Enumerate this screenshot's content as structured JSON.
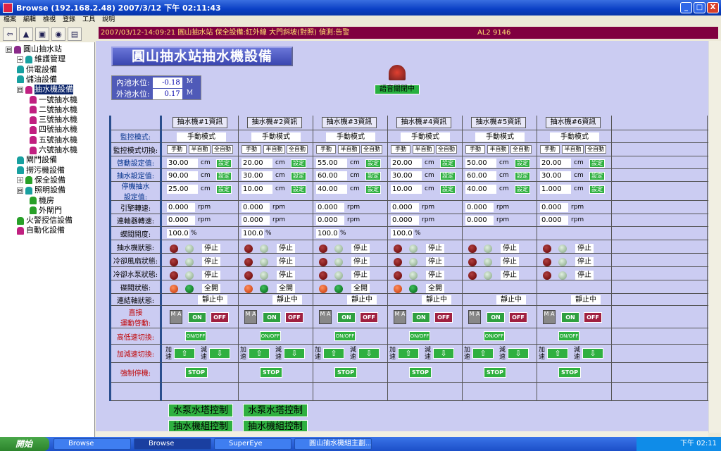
{
  "window": {
    "title": "Browse (192.168.2.48)   2007/3/12 下午 02:11:43",
    "min": "_",
    "max": "□",
    "close": "X"
  },
  "menu": [
    "檔案",
    "編輯",
    "檢視",
    "登錄",
    "工具",
    "說明"
  ],
  "toolbar": [
    "⇦",
    "▲",
    "▣",
    "◉",
    "▤"
  ],
  "alarm": {
    "text": "2007/03/12-14:09:21  圓山抽水站 保全設備:紅外線 大門斜坡(對照) 偵測:告警",
    "code": "AL2 9146"
  },
  "tree": [
    {
      "label": "圓山抽水站",
      "icon": "station-icon",
      "color": "#8a2a8a",
      "exp": "⊟"
    },
    {
      "label": "維護管理",
      "icon": "node-icon",
      "color": "#18a0a0",
      "exp": "+"
    },
    {
      "label": "供電設備",
      "icon": "node-icon",
      "color": "#18a0a0",
      "exp": ""
    },
    {
      "label": "儲油設備",
      "icon": "node-icon",
      "color": "#18a0a0",
      "exp": ""
    },
    {
      "label": "抽水機設備",
      "icon": "node-icon",
      "color": "#c02080",
      "exp": "⊟",
      "selected": true
    },
    {
      "label": "一號抽水機",
      "icon": "node-icon",
      "color": "#c02080",
      "exp": ""
    },
    {
      "label": "二號抽水機",
      "icon": "node-icon",
      "color": "#c02080",
      "exp": ""
    },
    {
      "label": "三號抽水機",
      "icon": "node-icon",
      "color": "#c02080",
      "exp": ""
    },
    {
      "label": "四號抽水機",
      "icon": "node-icon",
      "color": "#c02080",
      "exp": ""
    },
    {
      "label": "五號抽水機",
      "icon": "node-icon",
      "color": "#c02080",
      "exp": ""
    },
    {
      "label": "六號抽水機",
      "icon": "node-icon",
      "color": "#c02080",
      "exp": ""
    },
    {
      "label": "閘門設備",
      "icon": "node-icon",
      "color": "#18a0a0",
      "exp": ""
    },
    {
      "label": "撈污機設備",
      "icon": "node-icon",
      "color": "#18a0a0",
      "exp": ""
    },
    {
      "label": "保全設備",
      "icon": "node-icon",
      "color": "#28a028",
      "exp": "+"
    },
    {
      "label": "照明設備",
      "icon": "node-icon",
      "color": "#18a0a0",
      "exp": "⊟"
    },
    {
      "label": "機房",
      "icon": "node-icon",
      "color": "#28a028",
      "exp": ""
    },
    {
      "label": "外閘門",
      "icon": "node-icon",
      "color": "#28a028",
      "exp": ""
    },
    {
      "label": "火警授信設備",
      "icon": "node-icon",
      "color": "#28a028",
      "exp": ""
    },
    {
      "label": "自動化設備",
      "icon": "node-icon",
      "color": "#c02080",
      "exp": ""
    }
  ],
  "page": {
    "title": "圓山抽水站抽水機設備",
    "inner_label": "內池水位:",
    "inner_value": "-0.18",
    "outer_label": "外池水位:",
    "outer_value": "0.17",
    "level_unit": "M",
    "mute": "語音關閉中"
  },
  "labels": {
    "monitor": "監控模式:",
    "monitor_switch": "監控模式切換:",
    "start_set": "啓動設定值:",
    "pump_set": "抽水設定值:",
    "stop_set1": "停機抽水",
    "stop_set2": "設定值:",
    "engine": "引擎轉速:",
    "gear": "連軸器轉速:",
    "butterfly": "蝶閥開度:",
    "pump_state": "抽水機狀態:",
    "fan_state": "冷卻風扇狀態:",
    "cool_state": "冷卻水泵狀態:",
    "valve_state": "碟閥狀態:",
    "coupling_state": "連結軸狀態:",
    "direct1": "直接",
    "direct2": "運動啓動:",
    "hilo": "高低速切換:",
    "accel": "加減速切換:",
    "force_stop": "強制停機:"
  },
  "ui": {
    "manual_btn": "手動",
    "semi_btn": "半自動",
    "auto_btn": "全自動",
    "set_btn": "設定",
    "cm": "cm",
    "rpm": "rpm",
    "pct": "%",
    "on": "ON",
    "off": "OFF",
    "onoff": "ON/OFF",
    "stop": "STOP",
    "acc1": "加",
    "acc2": "速",
    "dec1": "減",
    "dec2": "速",
    "up": "⇧",
    "down": "⇩",
    "ma": "M A"
  },
  "pumps": [
    {
      "header": "抽水機#1資訊",
      "mode": "手動模式",
      "start": "30.00",
      "pump": "90.00",
      "stop": "25.00",
      "engine": "0.000",
      "gear": "0.000",
      "butterfly": "100.0",
      "pump_state": "停止",
      "fan_state": "停止",
      "cool_state": "停止",
      "valve_state": "全開",
      "coupling": "靜止中"
    },
    {
      "header": "抽水機#2資訊",
      "mode": "手動模式",
      "start": "20.00",
      "pump": "30.00",
      "stop": "10.00",
      "engine": "0.000",
      "gear": "0.000",
      "butterfly": "100.0",
      "pump_state": "停止",
      "fan_state": "停止",
      "cool_state": "停止",
      "valve_state": "全開",
      "coupling": "靜止中"
    },
    {
      "header": "抽水機#3資訊",
      "mode": "手動模式",
      "start": "55.00",
      "pump": "60.00",
      "stop": "40.00",
      "engine": "0.000",
      "gear": "0.000",
      "butterfly": "100.0",
      "pump_state": "停止",
      "fan_state": "停止",
      "cool_state": "停止",
      "valve_state": "全開",
      "coupling": "靜止中"
    },
    {
      "header": "抽水機#4資訊",
      "mode": "手動模式",
      "start": "20.00",
      "pump": "30.00",
      "stop": "10.00",
      "engine": "0.000",
      "gear": "0.000",
      "butterfly": "100.0",
      "pump_state": "停止",
      "fan_state": "停止",
      "cool_state": "停止",
      "valve_state": "全開",
      "coupling": "靜止中"
    },
    {
      "header": "抽水機#5資訊",
      "mode": "手動模式",
      "start": "50.00",
      "pump": "60.00",
      "stop": "40.00",
      "engine": "0.000",
      "gear": "0.000",
      "butterfly": "",
      "pump_state": "停止",
      "fan_state": "停止",
      "cool_state": "停止",
      "valve_state": "",
      "coupling": "靜止中"
    },
    {
      "header": "抽水機#6資訊",
      "mode": "手動模式",
      "start": "20.00",
      "pump": "30.00",
      "stop": "1.000",
      "engine": "0.000",
      "gear": "0.000",
      "butterfly": "",
      "pump_state": "停止",
      "fan_state": "停止",
      "cool_state": "停止",
      "valve_state": "",
      "coupling": "靜止中"
    }
  ],
  "bottom": {
    "tower1": "水泵水塔控制",
    "tower2": "水泵水塔控制",
    "group1": "抽水機組控制",
    "group2": "抽水機組控制"
  },
  "taskbar": {
    "start": "開始",
    "tasks": [
      "Browse",
      "Browse",
      "SuperEye",
      "圓山抽水機組主劃..."
    ],
    "clock": "下午 02:11"
  }
}
